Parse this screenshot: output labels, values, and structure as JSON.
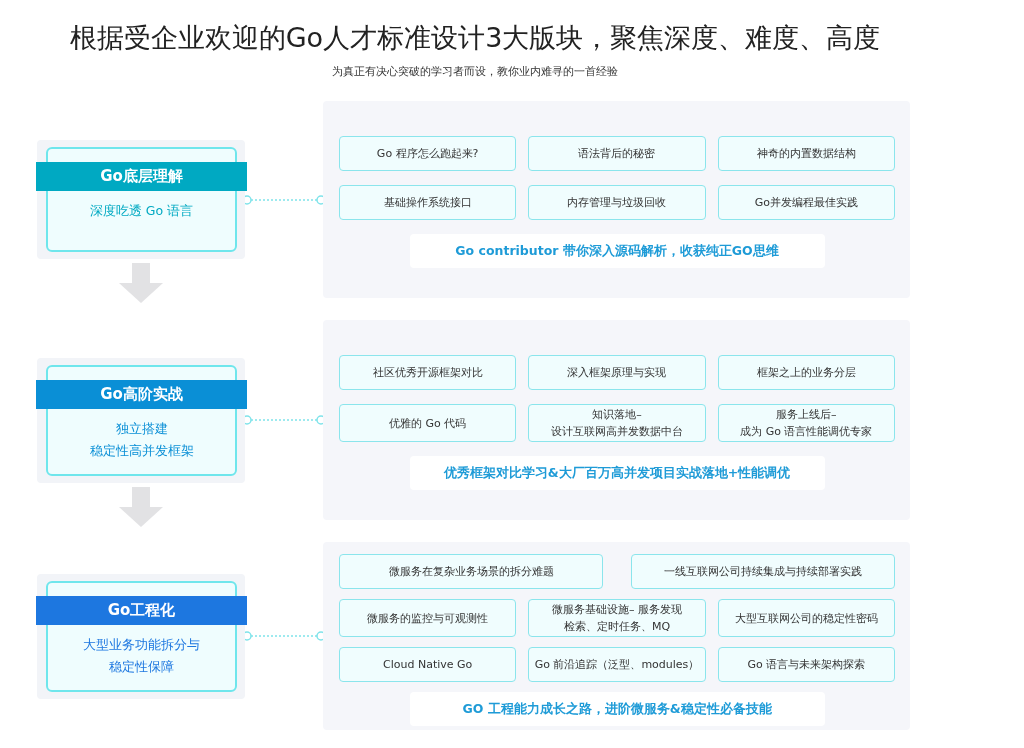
{
  "title": "根据受企业欢迎的Go人才标准设计3大版块，聚焦深度、难度、高度",
  "subtitle": "为真正有决心突破的学习者而设，教你业内难寻的一首经验",
  "modules": [
    {
      "name": "Go底层理解",
      "color": "#00a9c2",
      "description": [
        "深度吃透 Go 语言"
      ],
      "rows": [
        [
          "Go 程序怎么跑起来?",
          "语法背后的秘密",
          "神奇的内置数据结构"
        ],
        [
          "基础操作系统接口",
          "内存管理与垃圾回收",
          "Go并发编程最佳实践"
        ]
      ],
      "footer": "Go contributor 带你深入源码解析，收获纯正GO思维"
    },
    {
      "name": "Go高阶实战",
      "color": "#0a8fd6",
      "description": [
        "独立搭建",
        "稳定性高并发框架"
      ],
      "rows": [
        [
          "社区优秀开源框架对比",
          "深入框架原理与实现",
          "框架之上的业务分层"
        ],
        [
          "优雅的 Go 代码",
          [
            "知识落地–",
            "设计互联网高并发数据中台"
          ],
          [
            "服务上线后–",
            "成为 Go 语言性能调优专家"
          ]
        ]
      ],
      "footer": "优秀框架对比学习&大厂百万高并发项目实战落地+性能调优"
    },
    {
      "name": "Go工程化",
      "color": "#1d77e0",
      "description": [
        "大型业务功能拆分与",
        "稳定性保障"
      ],
      "rows": [
        [
          "微服务在复杂业务场景的拆分难题",
          "一线互联网公司持续集成与持续部署实践"
        ],
        [
          "微服务的监控与可观测性",
          [
            "微服务基础设施– 服务发现",
            "检索、定时任务、MQ"
          ],
          "大型互联网公司的稳定性密码"
        ],
        [
          "Cloud Native Go",
          "Go 前沿追踪（泛型、modules）",
          "Go 语言与未来架构探索"
        ]
      ],
      "footer": "GO 工程能力成长之路，进阶微服务&稳定性必备技能"
    }
  ]
}
